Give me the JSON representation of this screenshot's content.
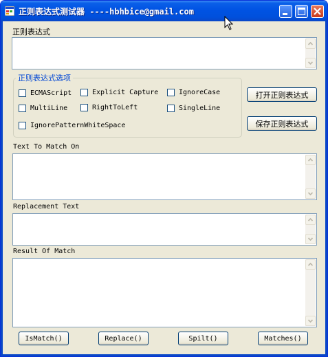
{
  "window": {
    "title": "正则表达式测试器 ----hbhbice@gmail.com",
    "icons": {
      "app": "app-icon",
      "minimize": "minimize-icon",
      "maximize": "maximize-icon",
      "close": "close-icon"
    }
  },
  "pattern": {
    "label": "正则表达式",
    "value": ""
  },
  "options": {
    "group_title": "正则表达式选项",
    "items": [
      {
        "label": "ECMAScript",
        "checked": false
      },
      {
        "label": "Explicit Capture",
        "checked": false
      },
      {
        "label": "IgnoreCase",
        "checked": false
      },
      {
        "label": "MultiLine",
        "checked": false
      },
      {
        "label": "RightToLeft",
        "checked": false
      },
      {
        "label": "SingleLine",
        "checked": false
      },
      {
        "label": "IgnorePatternWhiteSpace",
        "checked": false
      }
    ]
  },
  "side_buttons": {
    "open": "打开正则表达式",
    "save": "保存正则表达式"
  },
  "text_to_match": {
    "label": "Text To Match On",
    "value": ""
  },
  "replacement": {
    "label": "Replacement Text",
    "value": ""
  },
  "result": {
    "label": "Result Of Match",
    "value": ""
  },
  "bottom_buttons": {
    "ismatch": "IsMatch()",
    "replace": "Replace()",
    "split": "Spilt()",
    "matches": "Matches()"
  },
  "colors": {
    "titlebar": "#0053e3",
    "window_bg": "#ece9d8",
    "group_title": "#0046d5",
    "textbox_border": "#7f9db9"
  }
}
